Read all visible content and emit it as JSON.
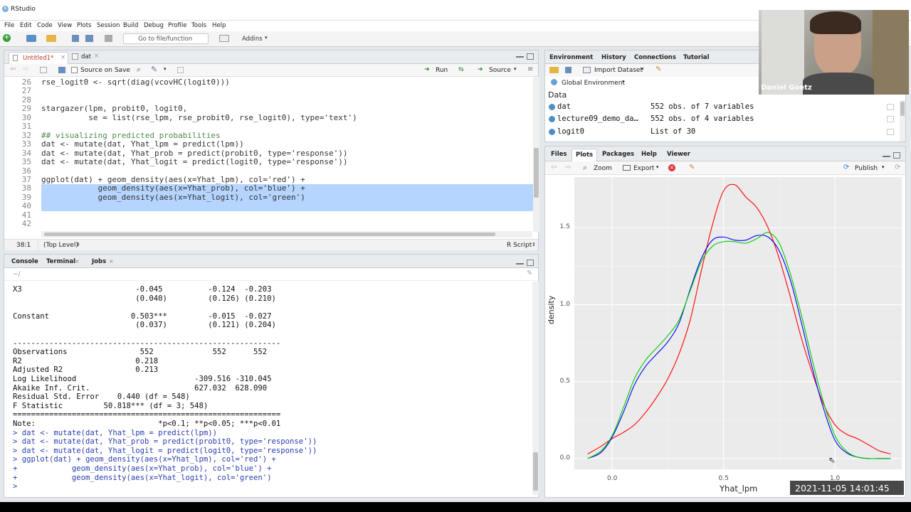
{
  "window": {
    "title": "RStudio",
    "logo_letter": "R"
  },
  "menu": [
    "File",
    "Edit",
    "Code",
    "View",
    "Plots",
    "Session",
    "Build",
    "Debug",
    "Profile",
    "Tools",
    "Help"
  ],
  "toolbar": {
    "goto_placeholder": "Go to file/function",
    "addins": "Addins"
  },
  "editor": {
    "tabs": [
      {
        "label": "Untitled1*",
        "active": true
      },
      {
        "label": "dat",
        "active": false
      }
    ],
    "source_on_save": "Source on Save",
    "run": "Run",
    "source": "Source",
    "lines": [
      {
        "n": "26",
        "text": "rse_logit0 <- sqrt(diag(vcovHC(logit0)))"
      },
      {
        "n": "27",
        "text": ""
      },
      {
        "n": "28",
        "text": ""
      },
      {
        "n": "29",
        "text": "stargazer(lpm, probit0, logit0,"
      },
      {
        "n": "30",
        "text": "          se = list(rse_lpm, rse_probit0, rse_logit0), type='text')"
      },
      {
        "n": "31",
        "text": ""
      },
      {
        "n": "32",
        "text": "## visualizing predicted probabilities"
      },
      {
        "n": "33",
        "text": "dat <- mutate(dat, Yhat_lpm = predict(lpm))"
      },
      {
        "n": "34",
        "text": "dat <- mutate(dat, Yhat_prob = predict(probit0, type='response'))"
      },
      {
        "n": "35",
        "text": "dat <- mutate(dat, Yhat_logit = predict(logit0, type='response'))"
      },
      {
        "n": "36",
        "text": ""
      },
      {
        "n": "37",
        "text": "ggplot(dat) + geom_density(aes(x=Yhat_lpm), col='red') +"
      },
      {
        "n": "38",
        "text": "            geom_density(aes(x=Yhat_prob), col='blue') +"
      },
      {
        "n": "39",
        "text": "            geom_density(aes(x=Yhat_logit), col='green')"
      },
      {
        "n": "40",
        "text": ""
      },
      {
        "n": "41",
        "text": ""
      },
      {
        "n": "42",
        "text": ""
      }
    ],
    "status_pos": "38:1",
    "status_scope": "(Top Level)",
    "status_type": "R Script"
  },
  "console": {
    "tabs": [
      "Console",
      "Terminal",
      "Jobs"
    ],
    "path": "~/",
    "lines": [
      {
        "text": "X3                         -0.045          -0.124  -0.203",
        "cmd": false
      },
      {
        "text": "                           (0.040)         (0.126) (0.210)",
        "cmd": false
      },
      {
        "text": "",
        "cmd": false
      },
      {
        "text": "Constant                  0.503***         -0.015  -0.027",
        "cmd": false
      },
      {
        "text": "                           (0.037)         (0.121) (0.204)",
        "cmd": false
      },
      {
        "text": "",
        "cmd": false
      },
      {
        "text": "-----------------------------------------------------------",
        "cmd": false
      },
      {
        "text": "Observations                552             552      552",
        "cmd": false
      },
      {
        "text": "R2                         0.218",
        "cmd": false
      },
      {
        "text": "Adjusted R2                0.213",
        "cmd": false
      },
      {
        "text": "Log Likelihood                          -309.516 -310.045",
        "cmd": false
      },
      {
        "text": "Akaike Inf. Crit.                       627.032  628.090",
        "cmd": false
      },
      {
        "text": "Residual Std. Error    0.440 (df = 548)",
        "cmd": false
      },
      {
        "text": "F Statistic         50.818*** (df = 3; 548)",
        "cmd": false
      },
      {
        "text": "===========================================================",
        "cmd": false
      },
      {
        "text": "Note:                           *p<0.1; **p<0.05; ***p<0.01",
        "cmd": false
      },
      {
        "text": "> dat <- mutate(dat, Yhat_lpm = predict(lpm))",
        "cmd": true
      },
      {
        "text": "> dat <- mutate(dat, Yhat_prob = predict(probit0, type='response'))",
        "cmd": true
      },
      {
        "text": "> dat <- mutate(dat, Yhat_logit = predict(logit0, type='response'))",
        "cmd": true
      },
      {
        "text": "> ggplot(dat) + geom_density(aes(x=Yhat_lpm), col='red') +",
        "cmd": true
      },
      {
        "text": "+            geom_density(aes(x=Yhat_prob), col='blue') +",
        "cmd": true
      },
      {
        "text": "+            geom_density(aes(x=Yhat_logit), col='green')",
        "cmd": true
      },
      {
        "text": "> ",
        "cmd": true
      }
    ]
  },
  "environment": {
    "tabs": [
      "Environment",
      "History",
      "Connections",
      "Tutorial"
    ],
    "import_dataset": "Import Dataset",
    "scope": "Global Environment",
    "section": "Data",
    "rows": [
      {
        "name": "dat",
        "value": "552 obs. of 7 variables"
      },
      {
        "name": "lecture09_demo_da…",
        "value": "552 obs. of 4 variables"
      },
      {
        "name": "logit0",
        "value": "List of 30"
      }
    ]
  },
  "plots_pane": {
    "tabs": [
      "Files",
      "Plots",
      "Packages",
      "Help",
      "Viewer"
    ],
    "zoom": "Zoom",
    "export": "Export",
    "publish": "Publish"
  },
  "chart_data": {
    "type": "line",
    "xlabel": "Yhat_lpm",
    "ylabel": "density",
    "xlim": [
      -0.17,
      1.3
    ],
    "ylim": [
      -0.07,
      1.83
    ],
    "xticks": [
      0.0,
      0.5,
      1.0
    ],
    "yticks": [
      0.0,
      0.5,
      1.0,
      1.5
    ],
    "xtick_labels": [
      "0.0",
      "0.5",
      "1.0"
    ],
    "ytick_labels": [
      "0.0",
      "0.5",
      "1.0",
      "1.5"
    ],
    "grid": true,
    "series": [
      {
        "color": "#ff0000",
        "x": [
          -0.11,
          -0.05,
          0.0,
          0.05,
          0.1,
          0.15,
          0.2,
          0.25,
          0.3,
          0.35,
          0.4,
          0.45,
          0.5,
          0.55,
          0.6,
          0.65,
          0.7,
          0.75,
          0.8,
          0.85,
          0.9,
          0.95,
          1.0,
          1.05,
          1.1,
          1.15,
          1.2,
          1.25
        ],
        "y": [
          0.03,
          0.08,
          0.13,
          0.17,
          0.22,
          0.3,
          0.4,
          0.52,
          0.68,
          0.9,
          1.22,
          1.52,
          1.74,
          1.78,
          1.7,
          1.63,
          1.5,
          1.3,
          1.05,
          0.78,
          0.55,
          0.35,
          0.22,
          0.16,
          0.13,
          0.09,
          0.05,
          0.03
        ]
      },
      {
        "color": "#0000ff",
        "x": [
          -0.11,
          -0.05,
          0.0,
          0.05,
          0.1,
          0.15,
          0.2,
          0.25,
          0.3,
          0.35,
          0.4,
          0.45,
          0.5,
          0.55,
          0.6,
          0.65,
          0.7,
          0.75,
          0.8,
          0.85,
          0.9,
          0.95,
          1.0,
          1.05,
          1.1,
          1.15,
          1.2,
          1.25
        ],
        "y": [
          0.0,
          0.04,
          0.14,
          0.3,
          0.48,
          0.6,
          0.68,
          0.76,
          0.88,
          1.1,
          1.3,
          1.42,
          1.44,
          1.42,
          1.42,
          1.45,
          1.44,
          1.35,
          1.16,
          0.88,
          0.58,
          0.32,
          0.12,
          0.04,
          0.01,
          0.0,
          0.0,
          0.0
        ]
      },
      {
        "color": "#00cc00",
        "x": [
          -0.11,
          -0.05,
          0.0,
          0.05,
          0.1,
          0.15,
          0.2,
          0.25,
          0.3,
          0.35,
          0.4,
          0.45,
          0.5,
          0.55,
          0.6,
          0.65,
          0.7,
          0.75,
          0.8,
          0.85,
          0.9,
          0.95,
          1.0,
          1.05,
          1.1,
          1.15,
          1.2,
          1.25
        ],
        "y": [
          0.0,
          0.05,
          0.15,
          0.33,
          0.52,
          0.64,
          0.72,
          0.8,
          0.9,
          1.09,
          1.28,
          1.38,
          1.41,
          1.41,
          1.4,
          1.43,
          1.47,
          1.4,
          1.2,
          0.93,
          0.63,
          0.36,
          0.15,
          0.05,
          0.01,
          0.0,
          0.0,
          0.0
        ]
      }
    ]
  },
  "overlay": {
    "presenter": "Daniel Goetz",
    "timestamp": "2021-11-05 14:01:45"
  }
}
